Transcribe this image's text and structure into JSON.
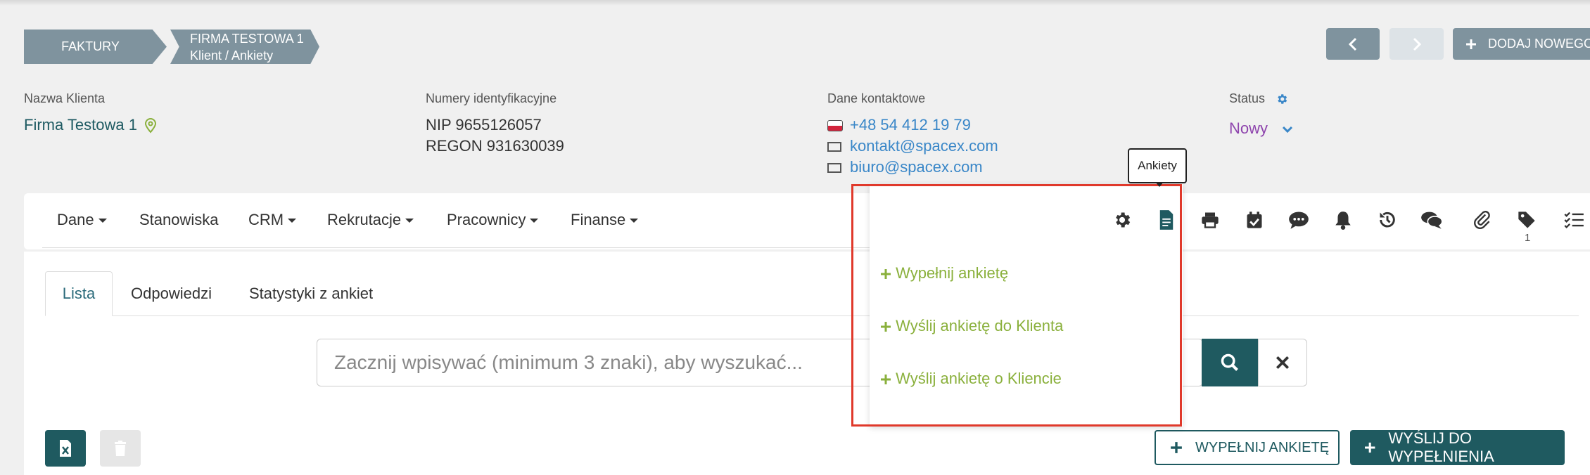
{
  "breadcrumb": {
    "first": "FAKTURY",
    "second_line1": "FIRMA TESTOWA 1",
    "second_line2": "Klient / Ankiety"
  },
  "header_buttons": {
    "add_new": "DODAJ NOWEGO"
  },
  "client": {
    "name_label": "Nazwa Klienta",
    "name": "Firma Testowa 1",
    "ids_label": "Numery identyfikacyjne",
    "nip": "NIP 9655126057",
    "regon": "REGON 931630039",
    "contact_label": "Dane kontaktowe",
    "phone": "+48 54 412 19 79",
    "email1": "kontakt@spacex.com",
    "email2": "biuro@spacex.com",
    "status_label": "Status",
    "status_value": "Nowy"
  },
  "menu": {
    "items": [
      "Dane",
      "Stanowiska",
      "CRM",
      "Rekrutacje",
      "Pracownicy",
      "Finanse"
    ]
  },
  "toolbar": {
    "tooltip": "Ankiety",
    "tag_count": "1"
  },
  "dropdown": {
    "items": [
      "Wypełnij ankietę",
      "Wyślij ankietę do Klienta",
      "Wyślij ankietę o Kliencie"
    ]
  },
  "tabs": [
    "Lista",
    "Odpowiedzi",
    "Statystyki z ankiet"
  ],
  "search": {
    "placeholder": "Zacznij wpisywać (minimum 3 znaki), aby wyszukać..."
  },
  "actions": {
    "fill": "WYPEŁNIJ ANKIETĘ",
    "send": "WYŚLIJ DO WYPEŁNIENIA"
  },
  "colors": {
    "primary": "#1f5a60",
    "breadcrumb": "#7f939e",
    "link": "#3a87c8",
    "dropdown_item": "#8ab03c",
    "highlight": "#e0392b"
  }
}
